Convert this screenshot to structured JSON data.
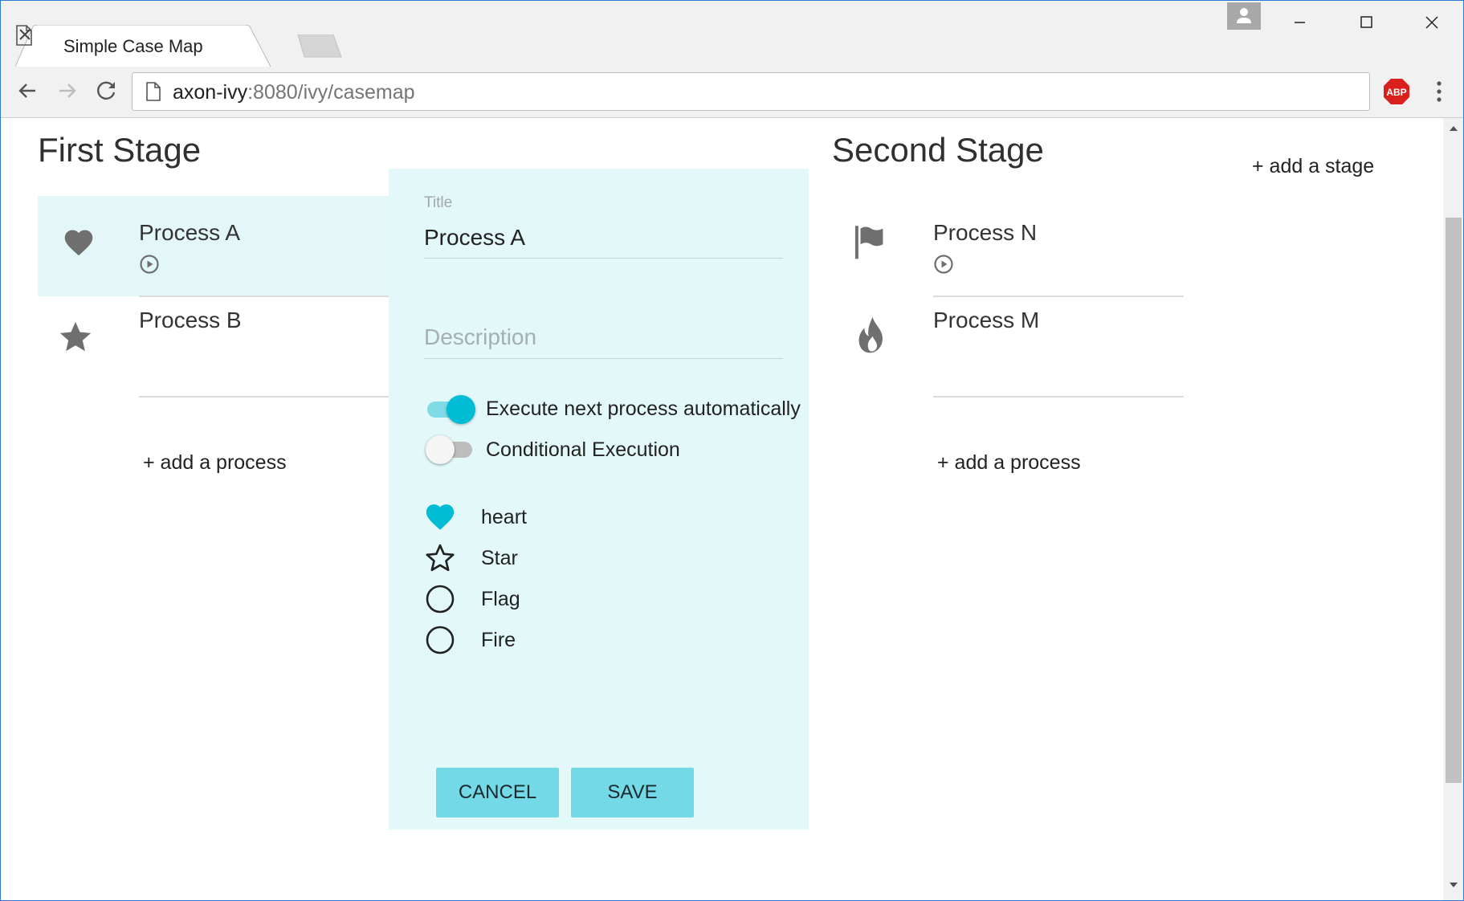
{
  "browser": {
    "tab_title": "Simple Case Map",
    "url_host": "axon-ivy",
    "url_rest": ":8080/ivy/casemap"
  },
  "stages": [
    {
      "title": "First Stage",
      "processes": [
        {
          "name": "Process A",
          "icon": "heart-icon",
          "has_start": true
        },
        {
          "name": "Process B",
          "icon": "star-icon",
          "has_start": false
        }
      ],
      "add_process_label": "+ add a process"
    },
    {
      "title": "Second Stage",
      "processes": [
        {
          "name": "Process N",
          "icon": "flag-icon",
          "has_start": true
        },
        {
          "name": "Process M",
          "icon": "fire-icon",
          "has_start": false
        }
      ],
      "add_process_label": "+ add a process"
    }
  ],
  "add_stage_label": "+ add a stage",
  "editor": {
    "title_label": "Title",
    "title_value": "Process A",
    "description_placeholder": "Description",
    "toggles": [
      {
        "label": "Execute next process automatically",
        "on": true
      },
      {
        "label": "Conditional Execution",
        "on": false
      }
    ],
    "icon_options": [
      {
        "label": "heart",
        "selected": true
      },
      {
        "label": "Star",
        "selected": false
      },
      {
        "label": "Flag",
        "selected": false
      },
      {
        "label": "Fire",
        "selected": false
      }
    ],
    "cancel_label": "CANCEL",
    "save_label": "SAVE"
  },
  "colors": {
    "accent": "#00bcd4",
    "selected_bg": "#e3f7f8",
    "button_bg": "#74d9e6",
    "icon_gray": "#6f6f6f"
  }
}
